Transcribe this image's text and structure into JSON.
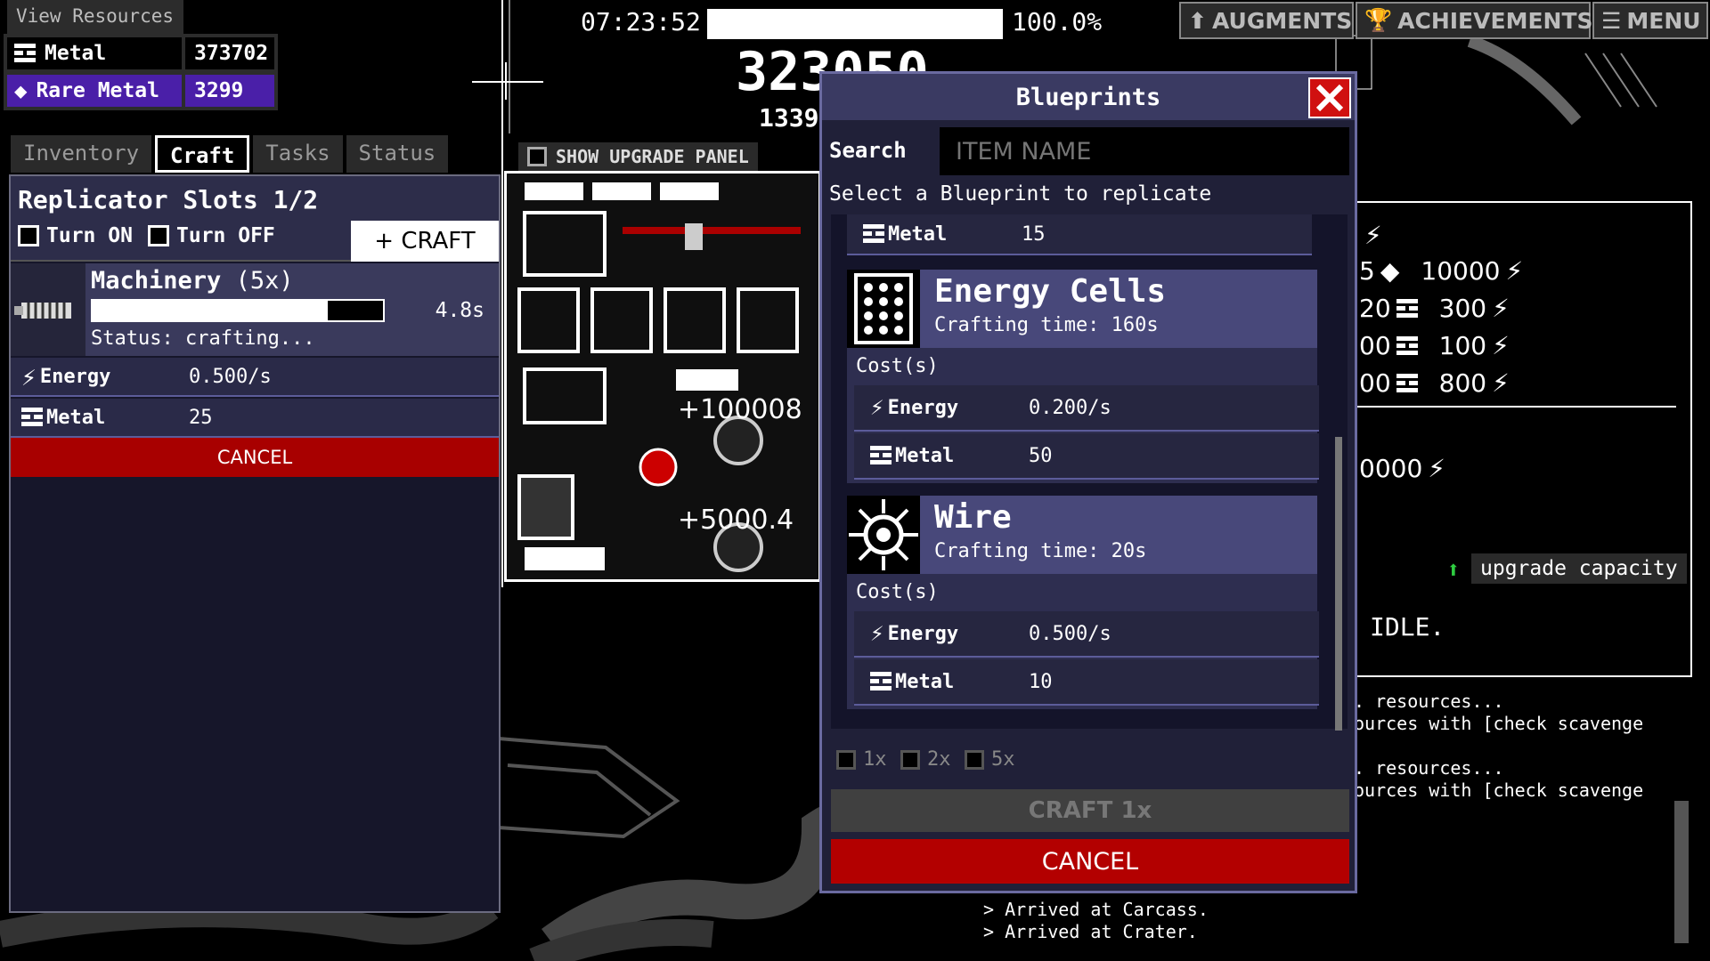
{
  "resources": {
    "title": "View Resources",
    "metal": {
      "label": "Metal",
      "value": "373702"
    },
    "rare_metal": {
      "label": "Rare Metal",
      "value": "3299"
    }
  },
  "tabs": [
    "Inventory",
    "Craft",
    "Tasks",
    "Status"
  ],
  "craft": {
    "slots_title": "Replicator Slots 1/2",
    "turn_on": "Turn ON",
    "turn_off": "Turn OFF",
    "craft_button": "+ CRAFT",
    "job": {
      "name": "Machinery",
      "qty": "(5x)",
      "progress": 0.81,
      "time": "4.8s",
      "status": "Status: crafting..."
    },
    "costs": [
      {
        "name": "Energy",
        "value": "0.500/s"
      },
      {
        "name": "Metal",
        "value": "25"
      }
    ],
    "cancel": "CANCEL"
  },
  "top": {
    "clock": "07:23:52",
    "percent": "100.0%",
    "progress": 1.0,
    "energy_big": "323050",
    "energy_sub": "1339",
    "buttons": [
      "AUGMENTS",
      "ACHIEVEMENTS",
      "MENU"
    ]
  },
  "upgrade_panel": {
    "show_label": "SHOW UPGRADE PANEL",
    "floats": [
      "+100008",
      "+5000.4"
    ]
  },
  "right_panel": {
    "lines": [
      "5",
      "10000",
      "20",
      "300",
      "00",
      "100",
      "00",
      "800",
      "0000"
    ],
    "upgrade_capacity": "upgrade capacity",
    "idle": "IDLE.",
    "log": [
      ". resources...",
      "ources with [check scavenge",
      ". resources...",
      "ources with [check scavenge"
    ],
    "log_bottom": [
      "> Arrived at Carcass.",
      "> Arrived at Crater."
    ]
  },
  "blueprints": {
    "title": "Blueprints",
    "search_label": "Search",
    "search_placeholder": "ITEM NAME",
    "select_text": "Select a Blueprint to replicate",
    "top_row": {
      "name": "Metal",
      "value": "15"
    },
    "items": [
      {
        "name": "Energy Cells",
        "time": "Crafting time: 160s",
        "costs_label": "Cost(s)",
        "costs": [
          {
            "name": "Energy",
            "value": "0.200/s"
          },
          {
            "name": "Metal",
            "value": "50"
          }
        ]
      },
      {
        "name": "Wire",
        "time": "Crafting time: 20s",
        "costs_label": "Cost(s)",
        "costs": [
          {
            "name": "Energy",
            "value": "0.500/s"
          },
          {
            "name": "Metal",
            "value": "10"
          }
        ]
      }
    ],
    "multipliers": [
      "1x",
      "2x",
      "5x"
    ],
    "craft_button": "CRAFT 1x",
    "cancel": "CANCEL"
  },
  "colors": {
    "accent_purple": "#4a1fa8",
    "cancel_red": "#b30000",
    "close_red": "#d01010",
    "panel": "#2d2d4a"
  }
}
